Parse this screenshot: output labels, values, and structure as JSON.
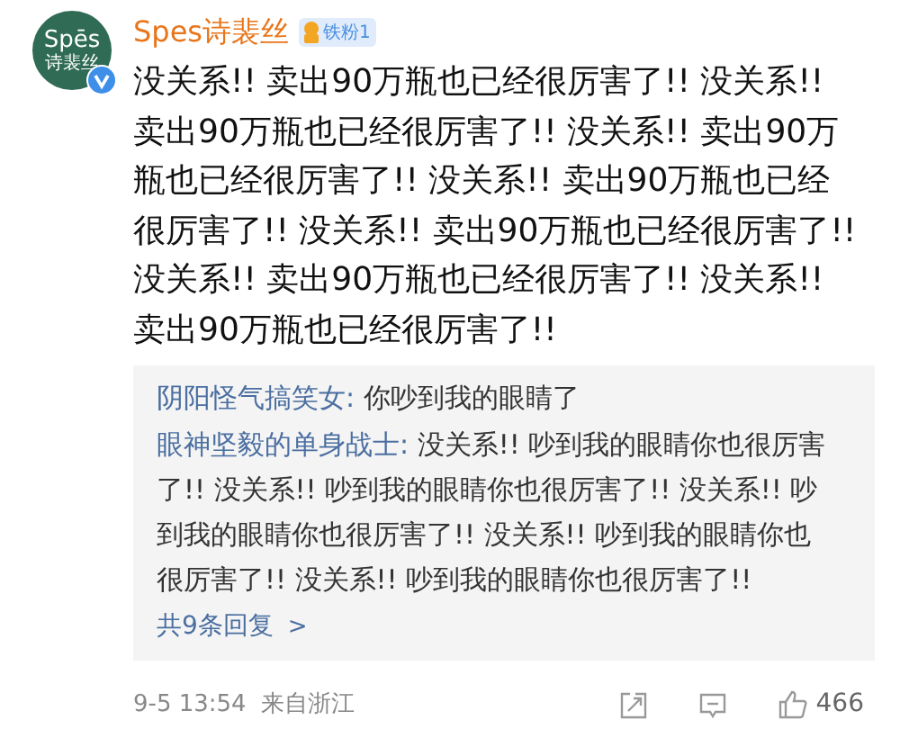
{
  "comment": {
    "avatar": {
      "line_1": "Spēs",
      "line_2": "诗裴丝",
      "verified": true
    },
    "author": "Spes诗裴丝",
    "fan_badge": "铁粉1",
    "text": "没关系!! 卖出90万瓶也已经很厉害了!! 没关系!! 卖出90万瓶也已经很厉害了!! 没关系!! 卖出90万瓶也已经很厉害了!! 没关系!! 卖出90万瓶也已经很厉害了!! 没关系!! 卖出90万瓶也已经很厉害了!! 没关系!! 卖出90万瓶也已经很厉害了!! 没关系!! 卖出90万瓶也已经很厉害了!!",
    "replies": [
      {
        "author": "阴阳怪气搞笑女:",
        "text": "你吵到我的眼睛了"
      },
      {
        "author": "眼神坚毅的单身战士:",
        "text": "没关系!! 吵到我的眼睛你也很厉害了!! 没关系!! 吵到我的眼睛你也很厉害了!! 没关系!! 吵到我的眼睛你也很厉害了!! 没关系!! 吵到我的眼睛你也很厉害了!! 没关系!! 吵到我的眼睛你也很厉害了!!"
      }
    ],
    "more_replies": "共9条回复",
    "more_arrow": ">",
    "date": "9-5 13:54",
    "location": "来自浙江",
    "likes": "466"
  }
}
